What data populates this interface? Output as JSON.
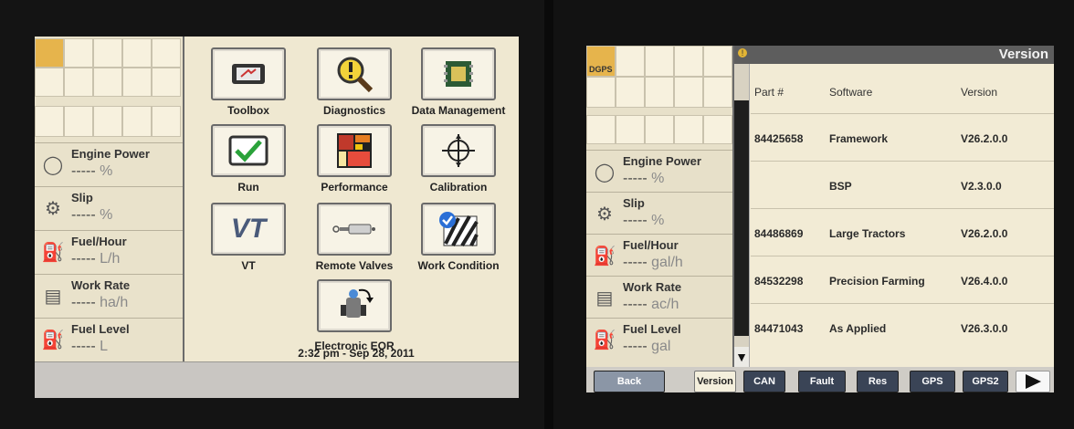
{
  "left": {
    "gauges": [
      {
        "label": "Engine Power",
        "value": "-----",
        "unit": "%"
      },
      {
        "label": "Slip",
        "value": "-----",
        "unit": "%"
      },
      {
        "label": "Fuel/Hour",
        "value": "-----",
        "unit": "L/h"
      },
      {
        "label": "Work Rate",
        "value": "-----",
        "unit": "ha/h"
      },
      {
        "label": "Fuel Level",
        "value": "-----",
        "unit": "L"
      }
    ],
    "apps": [
      {
        "label": "Toolbox"
      },
      {
        "label": "Diagnostics"
      },
      {
        "label": "Data Management"
      },
      {
        "label": "Run"
      },
      {
        "label": "Performance"
      },
      {
        "label": "Calibration"
      },
      {
        "label": "VT"
      },
      {
        "label": "Remote Valves"
      },
      {
        "label": "Work Condition"
      },
      {
        "label": "Electronic EOR"
      }
    ],
    "timestamp": "2:32 pm - Sep 28, 2011",
    "vt_glyph": "VT"
  },
  "right": {
    "grid_label": "DGPS",
    "title": "Version",
    "gauges": [
      {
        "label": "Engine Power",
        "value": "-----",
        "unit": "%"
      },
      {
        "label": "Slip",
        "value": "-----",
        "unit": "%"
      },
      {
        "label": "Fuel/Hour",
        "value": "-----",
        "unit": "gal/h"
      },
      {
        "label": "Work Rate",
        "value": "-----",
        "unit": "ac/h"
      },
      {
        "label": "Fuel Level",
        "value": "-----",
        "unit": "gal"
      }
    ],
    "table": {
      "headers": [
        "Part #",
        "Software",
        "Version"
      ],
      "rows": [
        [
          "84425658",
          "Framework",
          "V26.2.0.0"
        ],
        [
          "",
          "BSP",
          "V2.3.0.0"
        ],
        [
          "84486869",
          "Large Tractors",
          "V26.2.0.0"
        ],
        [
          "84532298",
          "Precision Farming",
          "V26.4.0.0"
        ],
        [
          "84471043",
          "As Applied",
          "V26.3.0.0"
        ]
      ]
    },
    "buttons": {
      "back": "Back",
      "version": "Version",
      "can": "CAN",
      "fault": "Fault",
      "res": "Res",
      "gps": "GPS",
      "gps2": "GPS2"
    }
  }
}
